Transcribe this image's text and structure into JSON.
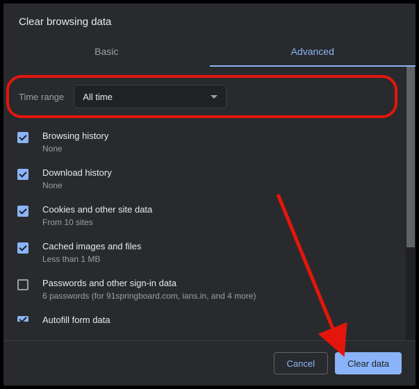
{
  "title": "Clear browsing data",
  "tabs": {
    "basic": "Basic",
    "advanced": "Advanced"
  },
  "time": {
    "label": "Time range",
    "value": "All time"
  },
  "options": [
    {
      "title": "Browsing history",
      "sub": "None",
      "checked": true
    },
    {
      "title": "Download history",
      "sub": "None",
      "checked": true
    },
    {
      "title": "Cookies and other site data",
      "sub": "From 10 sites",
      "checked": true
    },
    {
      "title": "Cached images and files",
      "sub": "Less than 1 MB",
      "checked": true
    },
    {
      "title": "Passwords and other sign-in data",
      "sub": "6 passwords (for 91springboard.com, ians.in, and 4 more)",
      "checked": false
    },
    {
      "title": "Autofill form data",
      "sub": "",
      "checked": true
    }
  ],
  "buttons": {
    "cancel": "Cancel",
    "clear": "Clear data"
  }
}
